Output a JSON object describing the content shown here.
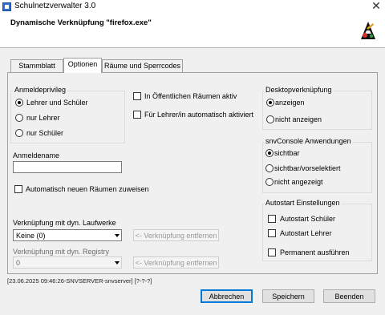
{
  "window": {
    "title": "Schulnetzverwalter 3.0",
    "header_title": "Dynamische Verknüpfung \"firefox.exe\"",
    "app_icon": "app-icon",
    "logo_icon": "ink-logo-icon",
    "close_icon": "close-icon"
  },
  "tabs": [
    {
      "label": "Stammblatt",
      "active": false
    },
    {
      "label": "Optionen",
      "active": true
    },
    {
      "label": "Räume und Sperrcodes",
      "active": false
    }
  ],
  "anmeldeprivileg": {
    "label": "Anmeldeprivileg",
    "options": [
      {
        "label": "Lehrer und Schüler",
        "selected": true
      },
      {
        "label": "nur Lehrer",
        "selected": false
      },
      {
        "label": "nur Schüler",
        "selected": false
      }
    ]
  },
  "checks_top": [
    {
      "label": "In Öffentlichen Räumen aktiv",
      "checked": false
    },
    {
      "label": "Für Lehrer/in automatisch aktiviert",
      "checked": false
    }
  ],
  "anmeldename": {
    "label": "Anmeldename",
    "value": ""
  },
  "auto_rooms": {
    "label": "Automatisch neuen Räumen zuweisen",
    "checked": false
  },
  "laufwerke": {
    "label": "Verknüpfung mit dyn. Laufwerke",
    "value": "Keine (0)",
    "button": "<- Verknüpfung entfernen"
  },
  "registry": {
    "label": "Verknüpfung mit dyn. Registry",
    "value": "0",
    "button": "<- Verknüpfung entfernen"
  },
  "desktop": {
    "label": "Desktopverknüpfung",
    "options": [
      {
        "label": "anzeigen",
        "selected": true
      },
      {
        "label": "nicht anzeigen",
        "selected": false
      }
    ]
  },
  "snvconsole": {
    "label": "snvConsole Anwendungen",
    "options": [
      {
        "label": "sichtbar",
        "selected": true
      },
      {
        "label": "sichtbar/vorselektiert",
        "selected": false
      },
      {
        "label": "nicht angezeigt",
        "selected": false
      }
    ]
  },
  "autostart": {
    "label": "Autostart Einstellungen",
    "options": [
      {
        "label": "Autostart Schüler",
        "checked": false
      },
      {
        "label": "Autostart Lehrer",
        "checked": false
      },
      {
        "label": "Permanent ausführen",
        "checked": false
      }
    ]
  },
  "status_text": "[23.06.2025 09:46:26-SNVSERVER-snvserver] [?-?-?]",
  "buttons": {
    "cancel": "Abbrechen",
    "save": "Speichern",
    "quit": "Beenden"
  }
}
